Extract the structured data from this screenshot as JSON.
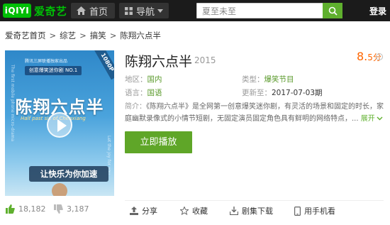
{
  "header": {
    "logo_mark": "iQIYI",
    "logo_text": "爱奇艺",
    "nav_home": "首页",
    "nav_guide": "导航",
    "search_placeholder": "夏至未至",
    "login": "登录"
  },
  "breadcrumb": [
    "爱奇艺首页",
    "综艺",
    "搞笑",
    "陈翔六点半"
  ],
  "poster": {
    "badge": "1080P",
    "small_text": "腾讯三屏联播独家出品",
    "tag": "创意爆笑迷你剧 NO.1",
    "title": "陈翔六点半",
    "subtitle": "Half past six of Chenxiang",
    "vertical_left": "The first mobile phone micro-drama",
    "vertical_right": "Let the joy for you",
    "slogan": "让快乐为你加速"
  },
  "show": {
    "title": "陈翔六点半",
    "year": "2015",
    "score_int": "8.",
    "score_dec": "5",
    "score_unit": "分",
    "region_label": "地区：",
    "region": "国内",
    "type_label": "类型：",
    "type": "爆笑节目",
    "language_label": "语言：",
    "language": "国语",
    "updated_label": "更新至：",
    "updated": "2017-07-03期",
    "intro_label": "简介：",
    "intro": "《陈翔六点半》是全网第一创意爆笑迷你剧，有灵活的场景和固定的时长，家庭幽默录像式的小情节短剧，无固定演员固定角色具有鲜明的网络特点，...",
    "expand": "展开",
    "play_button": "立即播放"
  },
  "votes": {
    "likes": "18,182",
    "dislikes": "3,187"
  },
  "actions": {
    "share": "分享",
    "favorite": "收藏",
    "download": "剧集下载",
    "mobile": "用手机看"
  },
  "colors": {
    "brand_green": "#00be06",
    "play_green": "#5fa628",
    "score_orange": "#ff6600",
    "topbar": "#1b1b1b"
  }
}
